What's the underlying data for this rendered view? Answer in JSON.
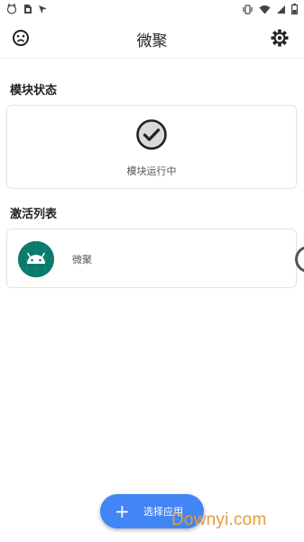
{
  "status_bar": {
    "left_icons": [
      "cat-face-icon",
      "sim-card-icon",
      "navigation-arrow-icon"
    ],
    "right_icons": [
      "vibrate-icon",
      "wifi-icon",
      "signal-icon",
      "battery-icon"
    ]
  },
  "app_bar": {
    "title": "微聚",
    "left_icon": "sad-face-icon",
    "right_icon": "gear-icon"
  },
  "module_status": {
    "section_title": "模块状态",
    "status_icon": "check-circle-icon",
    "status_text": "模块运行中"
  },
  "activation_list": {
    "section_title": "激活列表",
    "items": [
      {
        "name": "微聚",
        "icon": "android-icon",
        "icon_bg": "#0a7a6a"
      }
    ]
  },
  "fab": {
    "icon": "+",
    "label": "选择应用",
    "color": "#4285f4"
  },
  "watermark": {
    "text": "Downyi.com"
  },
  "colors": {
    "accent": "#4285f4",
    "android_green": "#0a7a6a"
  }
}
